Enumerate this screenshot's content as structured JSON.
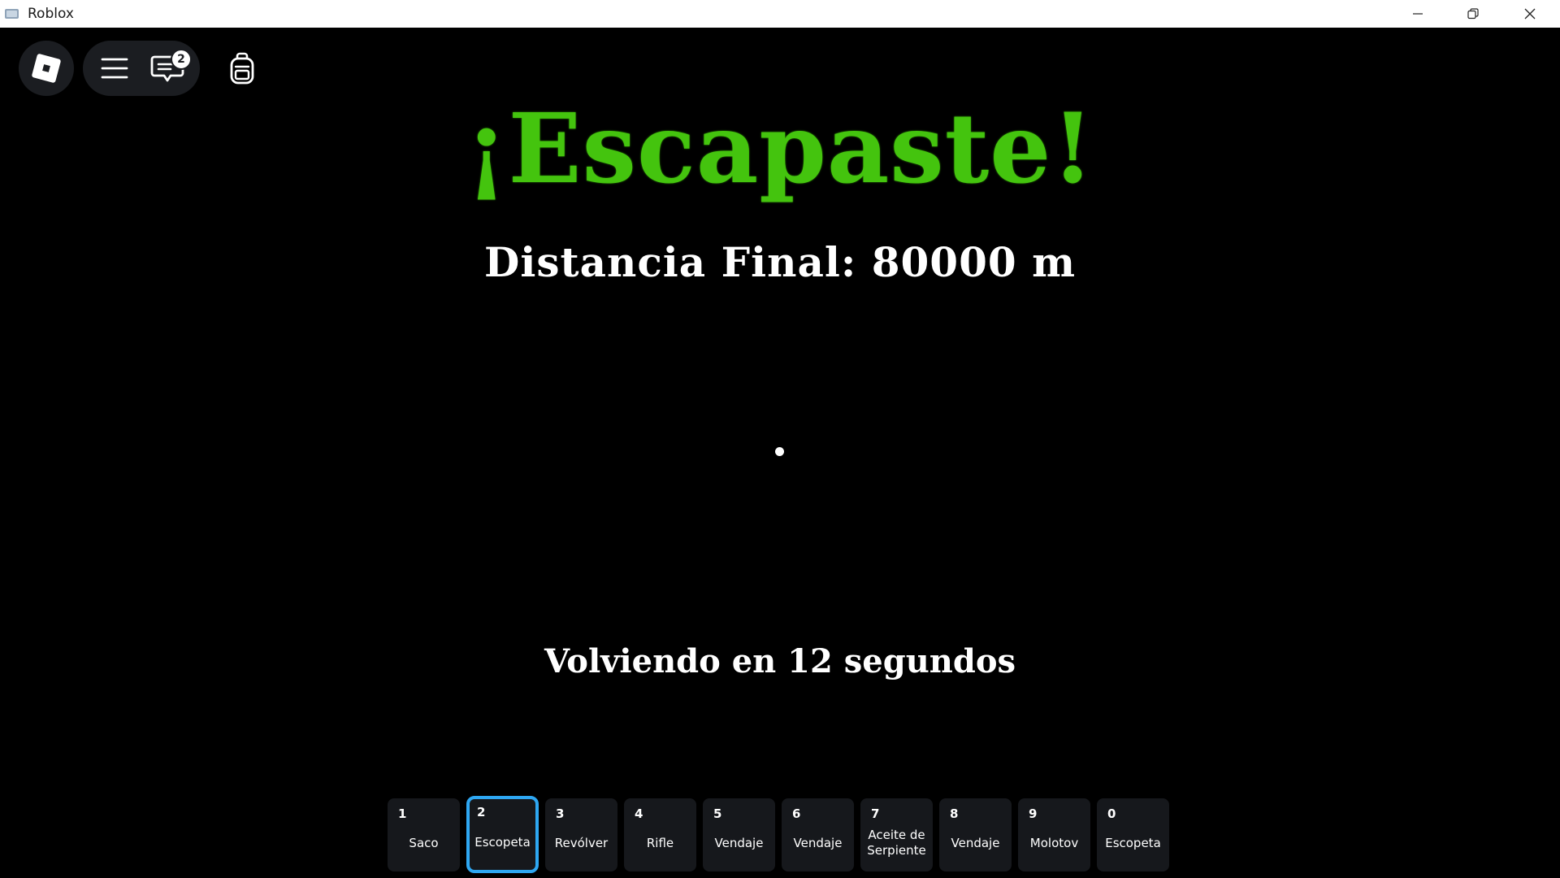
{
  "window": {
    "title": "Roblox"
  },
  "topbar": {
    "chat_badge_count": "2"
  },
  "game": {
    "title": "¡Escapaste!",
    "distance": "Distancia Final: 80000 m",
    "countdown": "Volviendo en 12 segundos",
    "title_color": "#44c40e"
  },
  "hotbar": {
    "selected_index": 1,
    "selected_color": "#2ea7f2",
    "slots": [
      {
        "key": "1",
        "label": "Saco"
      },
      {
        "key": "2",
        "label": "Escopeta"
      },
      {
        "key": "3",
        "label": "Revólver"
      },
      {
        "key": "4",
        "label": "Rifle"
      },
      {
        "key": "5",
        "label": "Vendaje"
      },
      {
        "key": "6",
        "label": "Vendaje"
      },
      {
        "key": "7",
        "label": "Aceite de Serpiente"
      },
      {
        "key": "8",
        "label": "Vendaje"
      },
      {
        "key": "9",
        "label": "Molotov"
      },
      {
        "key": "0",
        "label": "Escopeta"
      }
    ]
  },
  "icons": {
    "app": "roblox-app-icon",
    "minimize": "minimize-icon",
    "maximize": "restore-icon",
    "close": "close-icon",
    "logo": "roblox-logo-icon",
    "menu": "hamburger-menu-icon",
    "chat": "chat-icon",
    "backpack": "backpack-icon"
  }
}
